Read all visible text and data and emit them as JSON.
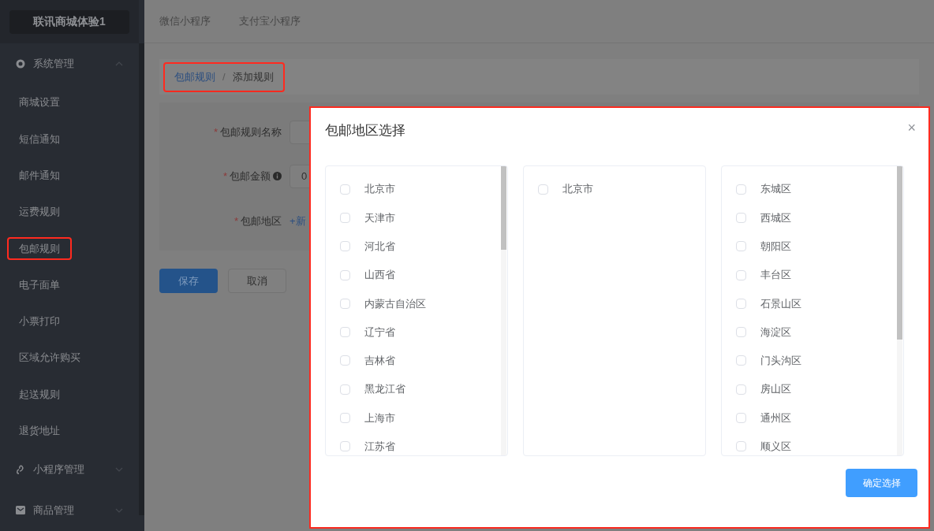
{
  "sidebar": {
    "logo": "联讯商城体验1",
    "groups": [
      {
        "label": "系统管理",
        "kind": "gear",
        "expanded": true,
        "items": [
          {
            "label": "商城设置",
            "highlighted": false
          },
          {
            "label": "短信通知",
            "highlighted": false
          },
          {
            "label": "邮件通知",
            "highlighted": false
          },
          {
            "label": "运费规则",
            "highlighted": false
          },
          {
            "label": "包邮规则",
            "highlighted": true
          },
          {
            "label": "电子面单",
            "highlighted": false
          },
          {
            "label": "小票打印",
            "highlighted": false
          },
          {
            "label": "区域允许购买",
            "highlighted": false
          },
          {
            "label": "起送规则",
            "highlighted": false
          },
          {
            "label": "退货地址",
            "highlighted": false
          }
        ]
      },
      {
        "label": "小程序管理",
        "kind": "link",
        "expanded": false
      },
      {
        "label": "商品管理",
        "kind": "mail",
        "expanded": false
      }
    ]
  },
  "header_tabs": [
    "微信小程序",
    "支付宝小程序"
  ],
  "breadcrumb": {
    "highlighted": true,
    "items": [
      "包邮规则",
      "添加规则"
    ],
    "separator": "/"
  },
  "form": {
    "fields": [
      {
        "kind": "text",
        "label": "包邮规则名称",
        "required_mark": "*"
      },
      {
        "kind": "amount",
        "label": "包邮金额",
        "required_mark": "*",
        "value": "0"
      },
      {
        "kind": "region",
        "label": "包邮地区",
        "required_mark": "*",
        "value": "+新"
      }
    ],
    "buttons": [
      {
        "label": "保存",
        "primary": true
      },
      {
        "label": "取消",
        "primary": false
      }
    ]
  },
  "dialog": {
    "title": "包邮地区选择",
    "close": "×",
    "highlighted": true,
    "columns": [
      {
        "scrollable": true,
        "items": [
          {
            "label": "北京市",
            "checked": false
          },
          {
            "label": "天津市",
            "checked": false
          },
          {
            "label": "河北省",
            "checked": false
          },
          {
            "label": "山西省",
            "checked": false
          },
          {
            "label": "内蒙古自治区",
            "checked": false
          },
          {
            "label": "辽宁省",
            "checked": false
          },
          {
            "label": "吉林省",
            "checked": false
          },
          {
            "label": "黑龙江省",
            "checked": false
          },
          {
            "label": "上海市",
            "checked": false
          },
          {
            "label": "江苏省",
            "checked": false
          }
        ]
      },
      {
        "items": [
          {
            "label": "北京市",
            "checked": false
          }
        ]
      },
      {
        "scrollable": true,
        "items": [
          {
            "label": "东城区",
            "checked": false
          },
          {
            "label": "西城区",
            "checked": false
          },
          {
            "label": "朝阳区",
            "checked": false
          },
          {
            "label": "丰台区",
            "checked": false
          },
          {
            "label": "石景山区",
            "checked": false
          },
          {
            "label": "海淀区",
            "checked": false
          },
          {
            "label": "门头沟区",
            "checked": false
          },
          {
            "label": "房山区",
            "checked": false
          },
          {
            "label": "通州区",
            "checked": false
          },
          {
            "label": "顺义区",
            "checked": false
          }
        ]
      }
    ],
    "confirm": "确定选择"
  }
}
